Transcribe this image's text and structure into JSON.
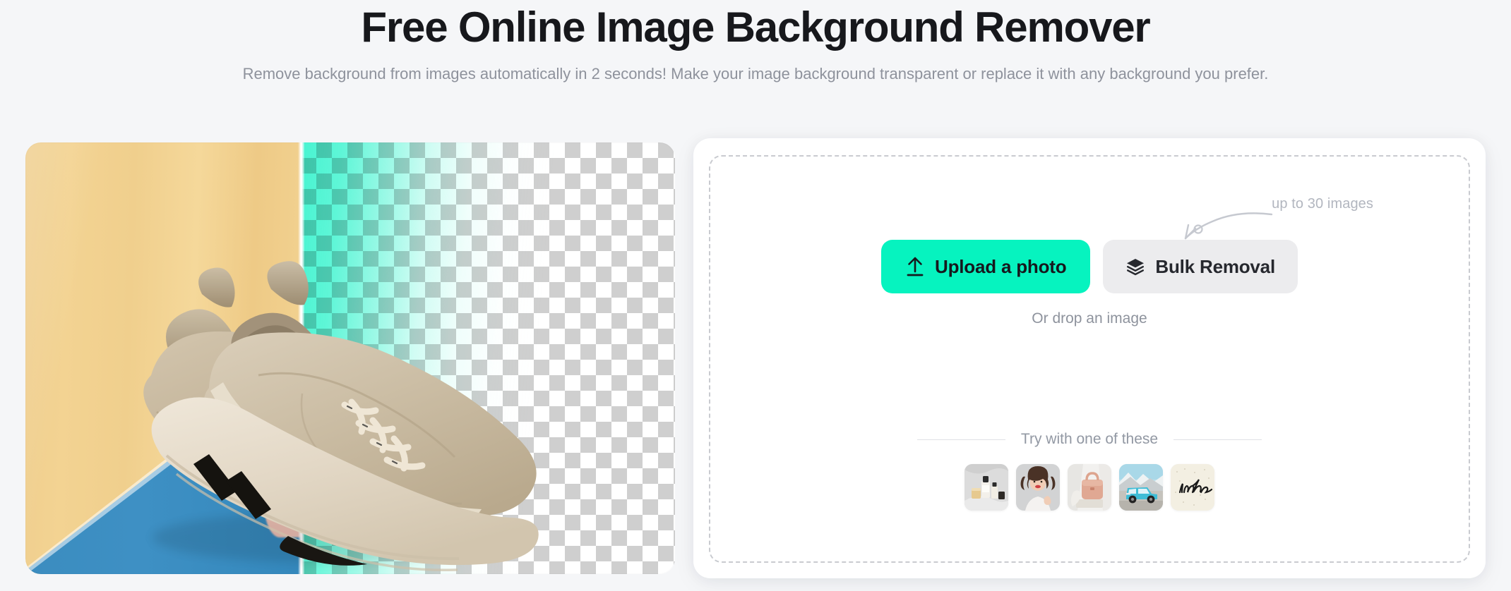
{
  "header": {
    "title": "Free Online Image Background Remover",
    "subtitle": "Remove background from images automatically in 2 seconds! Make your image background transparent or replace it with any background you prefer."
  },
  "preview": {
    "alt": "sneakers before and after background removal",
    "before_bg_colors": [
      "#f0d08f",
      "#3b8cbf"
    ],
    "after_checker_colors": [
      "#ffffff",
      "#cfcfcf"
    ],
    "highlight_color": "#38f3cd"
  },
  "upload": {
    "annotation": "up to 30 images",
    "upload_button_label": "Upload a photo",
    "upload_icon": "upload-arrow-icon",
    "bulk_button_label": "Bulk Removal",
    "bulk_icon": "layers-icon",
    "drop_hint": "Or drop an image",
    "accent_color": "#06f3bf",
    "bulk_bg_color": "#ececee"
  },
  "samples": {
    "divider_label": "Try with one of these",
    "items": [
      {
        "name": "skincare-bottles",
        "icon": "sample-skincare-icon"
      },
      {
        "name": "portrait-woman",
        "icon": "sample-portrait-icon"
      },
      {
        "name": "pink-handbag",
        "icon": "sample-handbag-icon"
      },
      {
        "name": "blue-suv-mountains",
        "icon": "sample-car-icon"
      },
      {
        "name": "insmind-logo",
        "icon": "sample-logo-icon"
      }
    ]
  }
}
